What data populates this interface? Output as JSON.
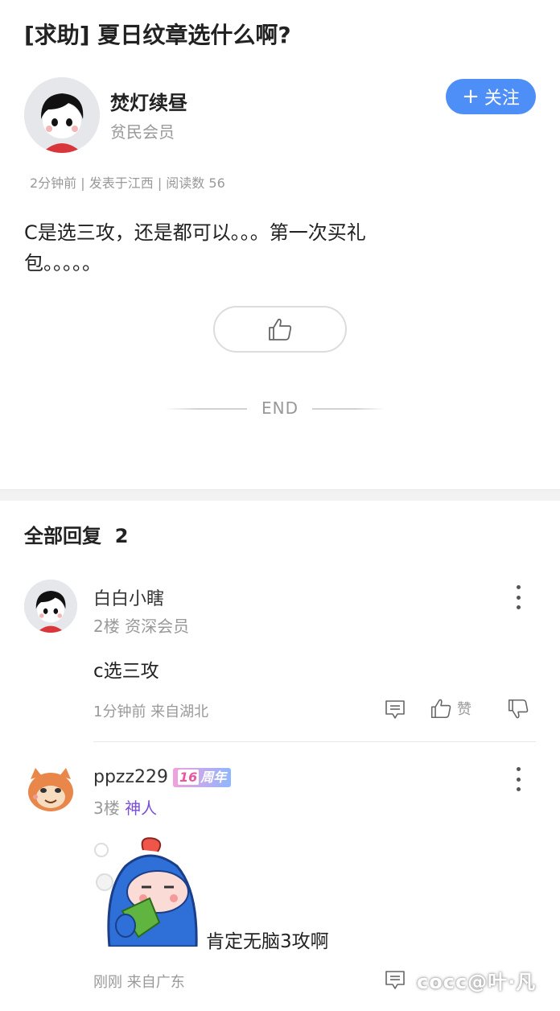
{
  "post": {
    "title": "[求助] 夏日纹章选什么啊?",
    "author": {
      "name": "焚灯续昼",
      "rank": "贫民会员"
    },
    "follow_label": "关注",
    "meta": "2分钟前 | 发表于江西 | 阅读数 56",
    "body_line1": "C是选三攻，还是都可以。。。第一次买礼",
    "body_line2": "包。。。。。",
    "end_label": "END"
  },
  "replies": {
    "header": "全部回复",
    "count": "2",
    "items": [
      {
        "user": "白白小瞎",
        "floor": "2楼",
        "rank": "资深会员",
        "text": "c选三攻",
        "meta": "1分钟前 来自湖北",
        "like_label": "赞"
      },
      {
        "user": "ppzz229",
        "badge_num": "16",
        "badge_text": "周年",
        "floor": "3楼",
        "rank": "神人",
        "rank_color": "#7b4fd8",
        "text": "肯定无脑3攻啊",
        "meta": "刚刚 来自广东"
      }
    ]
  },
  "watermark": "cocc@叶·凡",
  "colors": {
    "accent": "#4e8ef7",
    "muted": "#999999",
    "text": "#222222"
  }
}
